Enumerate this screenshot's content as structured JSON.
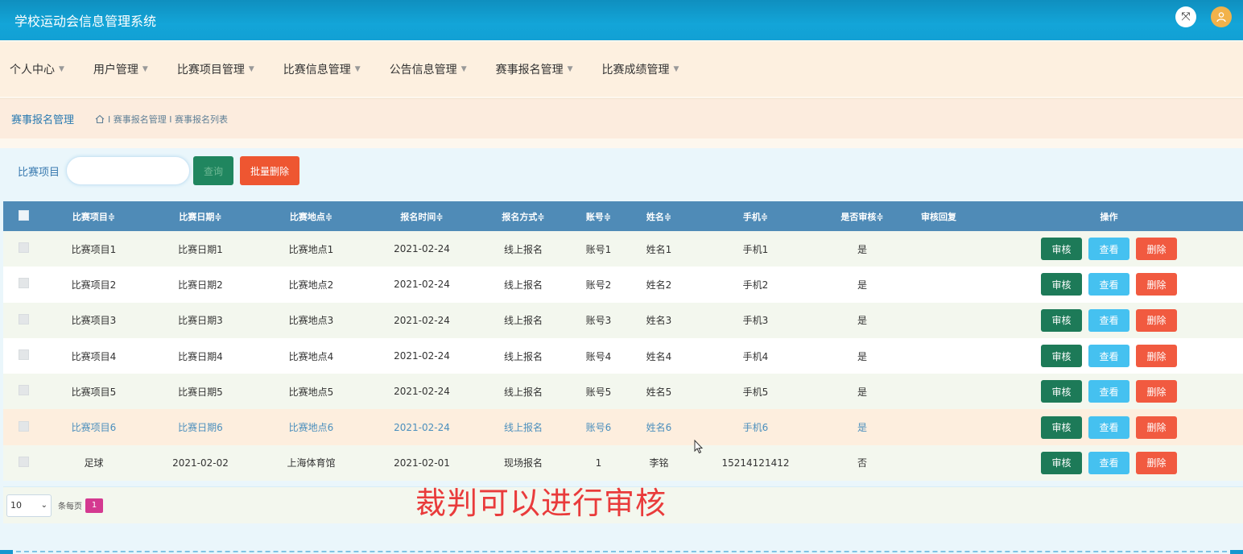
{
  "app": {
    "title": "学校运动会信息管理系统"
  },
  "topbar": {
    "fullscreen_icon": "fullscreen-icon",
    "avatar_icon": "user-avatar-icon"
  },
  "nav": [
    {
      "label": "个人中心"
    },
    {
      "label": "用户管理"
    },
    {
      "label": "比赛项目管理"
    },
    {
      "label": "比赛信息管理"
    },
    {
      "label": "公告信息管理"
    },
    {
      "label": "赛事报名管理"
    },
    {
      "label": "比赛成绩管理"
    }
  ],
  "breadcrumb": {
    "title": "赛事报名管理",
    "path": "I 赛事报名管理 I 赛事报名列表"
  },
  "search": {
    "label": "比赛项目",
    "value": "",
    "query_label": "查询",
    "batch_delete_label": "批量删除"
  },
  "table": {
    "headers": [
      "比赛项目≑",
      "比赛日期≑",
      "比赛地点≑",
      "报名时间≑",
      "报名方式≑",
      "账号≑",
      "姓名≑",
      "手机≑",
      "是否审核≑",
      "审核回复",
      "操作"
    ],
    "rows": [
      [
        "比赛项目1",
        "比赛日期1",
        "比赛地点1",
        "2021-02-24",
        "线上报名",
        "账号1",
        "姓名1",
        "手机1",
        "是",
        ""
      ],
      [
        "比赛项目2",
        "比赛日期2",
        "比赛地点2",
        "2021-02-24",
        "线上报名",
        "账号2",
        "姓名2",
        "手机2",
        "是",
        ""
      ],
      [
        "比赛项目3",
        "比赛日期3",
        "比赛地点3",
        "2021-02-24",
        "线上报名",
        "账号3",
        "姓名3",
        "手机3",
        "是",
        ""
      ],
      [
        "比赛项目4",
        "比赛日期4",
        "比赛地点4",
        "2021-02-24",
        "线上报名",
        "账号4",
        "姓名4",
        "手机4",
        "是",
        ""
      ],
      [
        "比赛项目5",
        "比赛日期5",
        "比赛地点5",
        "2021-02-24",
        "线上报名",
        "账号5",
        "姓名5",
        "手机5",
        "是",
        ""
      ],
      [
        "比赛项目6",
        "比赛日期6",
        "比赛地点6",
        "2021-02-24",
        "线上报名",
        "账号6",
        "姓名6",
        "手机6",
        "是",
        ""
      ],
      [
        "足球",
        "2021-02-02",
        "上海体育馆",
        "2021-02-01",
        "现场报名",
        "1",
        "李铭",
        "15214121412",
        "否",
        ""
      ]
    ],
    "actions": {
      "review": "审核",
      "view": "查看",
      "delete": "删除"
    },
    "hovered_row": 6
  },
  "pager": {
    "page_size": "10",
    "per_page_label": "条每页",
    "current_page": "1"
  },
  "overlay_text": "裁判可以进行审核",
  "colors": {
    "header": "#13a5d8",
    "table_head": "#4f8bb7",
    "review": "#1d7a58",
    "view": "#45c1f0",
    "delete": "#f15a40",
    "page_active": "#d43990",
    "overlay": "#e93b3b"
  }
}
